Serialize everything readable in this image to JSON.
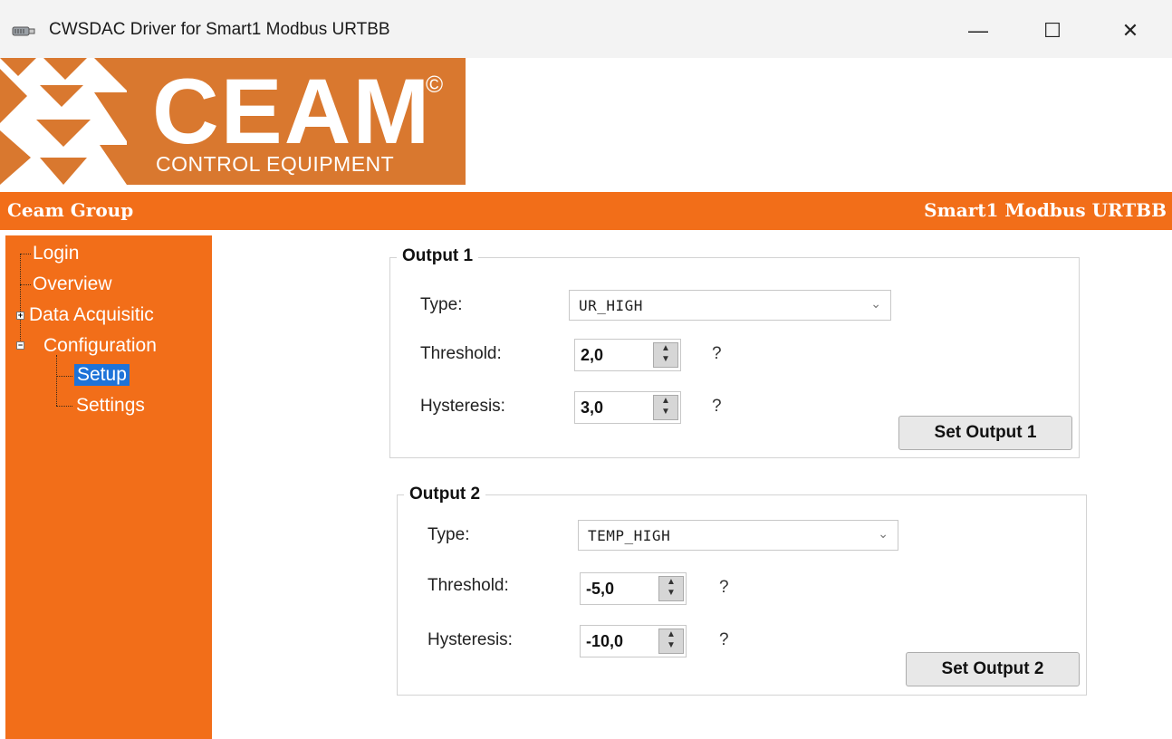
{
  "window": {
    "title": "CWSDAC Driver for Smart1 Modbus URTBB",
    "controls": {
      "minimize": "—",
      "maximize": "☐",
      "close": "✕"
    },
    "icon": "usb-cable-icon"
  },
  "logo": {
    "text": "CEAM",
    "copyright": "©",
    "subtitle": "CONTROL EQUIPMENT"
  },
  "header_bar": {
    "left": "Ceam Group",
    "right": "Smart1 Modbus URTBB"
  },
  "sidebar": {
    "items": [
      {
        "label": "Login"
      },
      {
        "label": "Overview"
      },
      {
        "label": "Data Acquisitic",
        "expander": "+"
      },
      {
        "label": "Configuration",
        "expander": "−"
      },
      {
        "label": "Setup",
        "selected": true
      },
      {
        "label": "Settings"
      }
    ]
  },
  "output1": {
    "title": "Output 1",
    "type_label": "Type:",
    "type_value": "UR_HIGH",
    "threshold_label": "Threshold:",
    "threshold_value": "2,0",
    "hysteresis_label": "Hysteresis:",
    "hysteresis_value": "3,0",
    "help": "?",
    "button": "Set Output 1"
  },
  "output2": {
    "title": "Output 2",
    "type_label": "Type:",
    "type_value": "TEMP_HIGH",
    "threshold_label": "Threshold:",
    "threshold_value": "-5,0",
    "hysteresis_label": "Hysteresis:",
    "hysteresis_value": "-10,0",
    "help": "?",
    "button": "Set Output 2"
  },
  "colors": {
    "brand_orange": "#f26e19",
    "logo_orange": "#d9782f",
    "selection_blue": "#1e73d8"
  }
}
